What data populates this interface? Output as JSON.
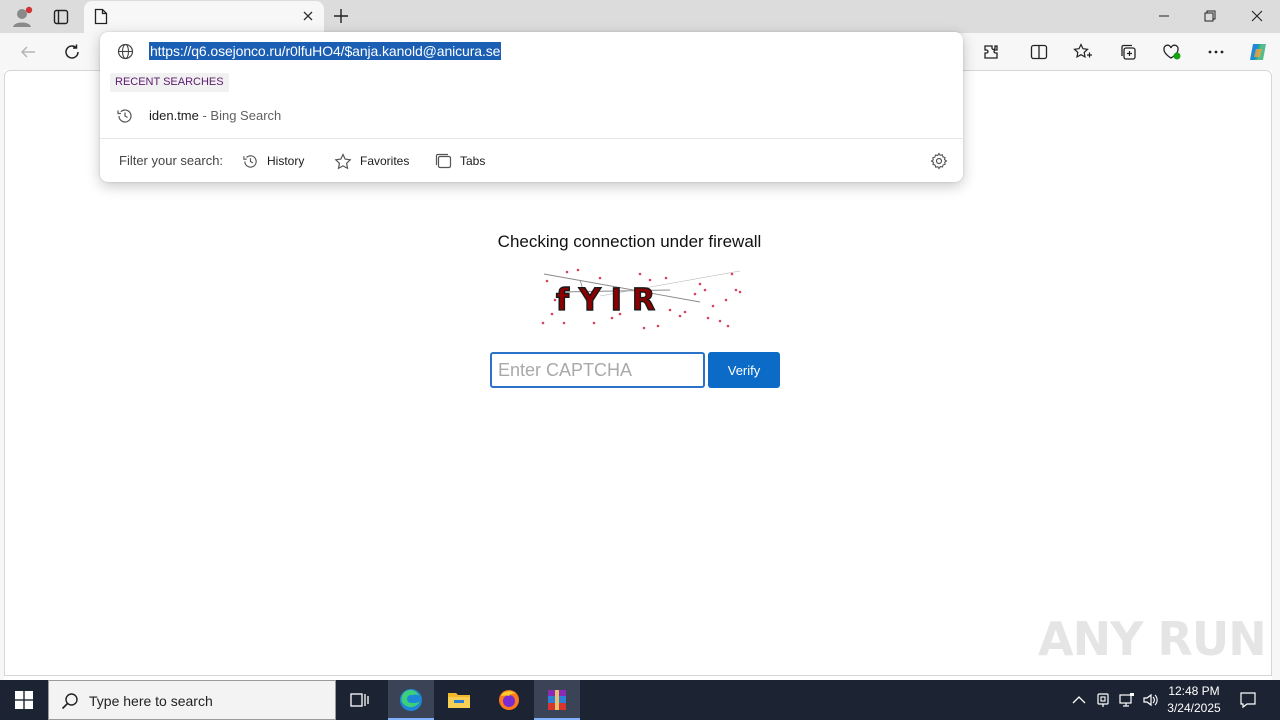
{
  "browser": {
    "url": "https://q6.osejonco.ru/r0lfuHO4/$anja.kanold@anicura.se"
  },
  "omnibox": {
    "recent_label": "RECENT SEARCHES",
    "suggestion_main": "iden.tme",
    "suggestion_sub": " - Bing Search",
    "filter_label": "Filter your search:",
    "filters": [
      "History",
      "Favorites",
      "Tabs"
    ]
  },
  "page": {
    "heading": "Checking connection under firewall",
    "captcha_text": "fYIR",
    "input_placeholder": "Enter CAPTCHA",
    "verify_label": "Verify"
  },
  "watermark": "ANY RUN",
  "taskbar": {
    "search_placeholder": "Type here to search",
    "time": "12:48 PM",
    "date": "3/24/2025"
  },
  "colors": {
    "accent": "#0b6bc6",
    "url_highlight": "#1a5fb4",
    "captcha_chars": "#8b0000",
    "taskbar": "#1c2433"
  }
}
